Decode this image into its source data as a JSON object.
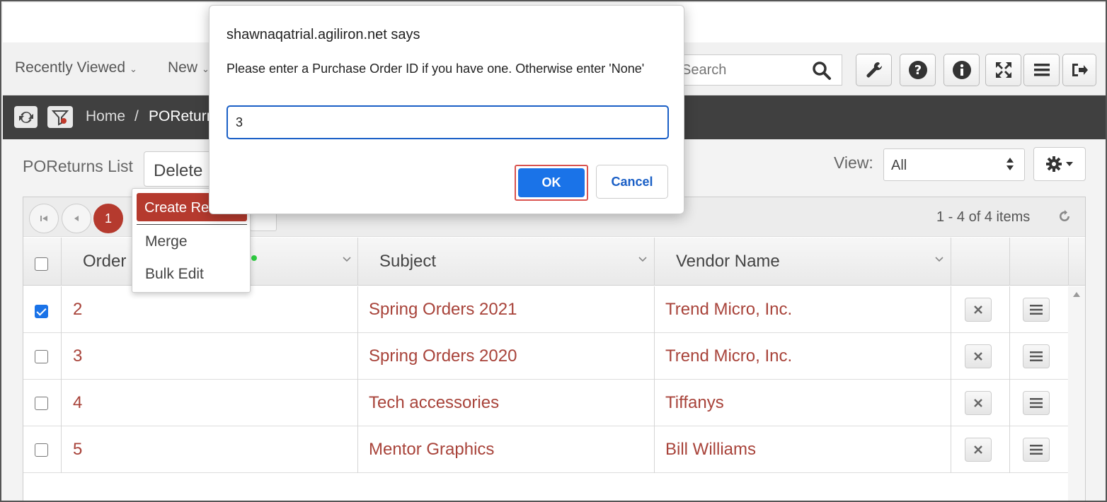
{
  "nav": {
    "recently_viewed": "Recently Viewed",
    "new": "New",
    "search_placeholder": "Search"
  },
  "toolbar_icons": [
    "wrench-icon",
    "help-icon",
    "info-icon",
    "fullscreen-icon",
    "hamburger-icon",
    "logout-icon"
  ],
  "breadcrumb": {
    "home": "Home",
    "separator": "/",
    "current": "POReturns"
  },
  "list": {
    "title": "POReturns List",
    "delete_label": "Delete",
    "view_label": "View:",
    "view_value": "All"
  },
  "dropdown": {
    "create_label": "Create Ret",
    "merge_label": "Merge",
    "bulk_edit_label": "Bulk Edit"
  },
  "pager": {
    "current_page": "1",
    "items_summary": "1 - 4 of 4 items"
  },
  "columns": {
    "order": "Order",
    "subject": "Subject",
    "vendor": "Vendor Name"
  },
  "rows": [
    {
      "order": "2",
      "subject": "Spring Orders 2021",
      "vendor": "Trend Micro, Inc.",
      "checked": true
    },
    {
      "order": "3",
      "subject": "Spring Orders 2020",
      "vendor": "Trend Micro, Inc.",
      "checked": false
    },
    {
      "order": "4",
      "subject": "Tech accessories",
      "vendor": "Tiffanys",
      "checked": false
    },
    {
      "order": "5",
      "subject": "Mentor Graphics",
      "vendor": "Bill Williams",
      "checked": false
    }
  ],
  "modal": {
    "title": "shawnaqatrial.agiliron.net says",
    "message": "Please enter a Purchase Order ID if you have one. Otherwise enter 'None'",
    "input_value": "3",
    "ok_label": "OK",
    "cancel_label": "Cancel"
  },
  "colors": {
    "accent_red": "#b53a2e",
    "link_red": "#a8433a",
    "primary_blue": "#1a73e8",
    "dark_bar": "#404040"
  }
}
